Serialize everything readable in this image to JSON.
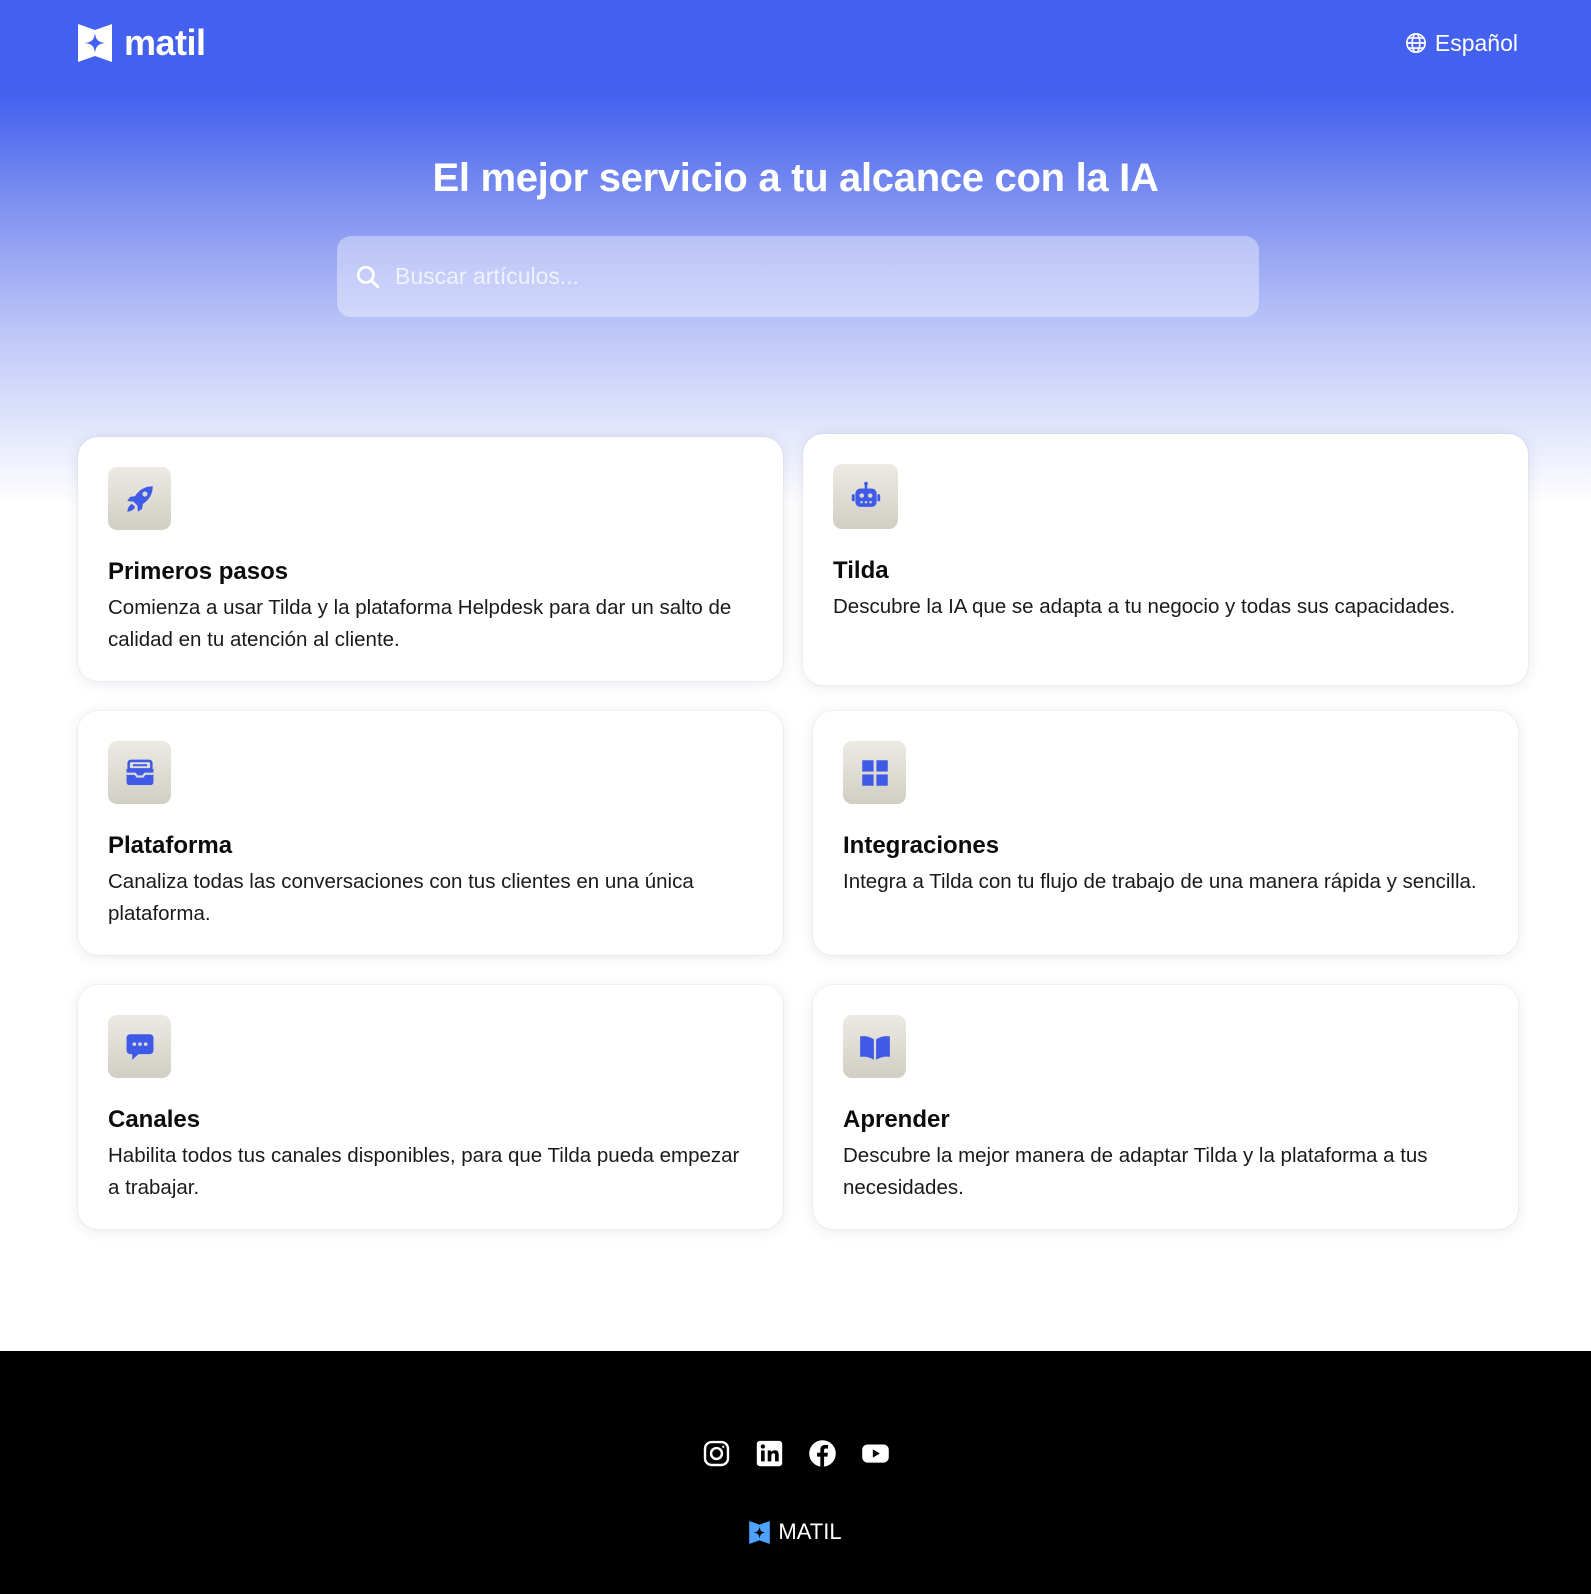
{
  "header": {
    "brand": "matil",
    "language": "Español"
  },
  "hero": {
    "title": "El mejor servicio a tu alcance con la IA",
    "search_placeholder": "Buscar artículos..."
  },
  "categories": [
    {
      "icon": "rocket-icon",
      "title": "Primeros pasos",
      "description": "Comienza a usar Tilda y la plataforma Helpdesk para dar un salto de calidad en tu atención al cliente."
    },
    {
      "icon": "robot-icon",
      "title": "Tilda",
      "description": "Descubre la IA que se adapta a tu negocio y todas sus capacidades."
    },
    {
      "icon": "inbox-icon",
      "title": "Plataforma",
      "description": "Canaliza todas las conversaciones con tus clientes en una única plataforma."
    },
    {
      "icon": "grid-icon",
      "title": "Integraciones",
      "description": "Integra a Tilda con tu flujo de trabajo de una manera rápida y sencilla."
    },
    {
      "icon": "chat-bubble-icon",
      "title": "Canales",
      "description": "Habilita todos tus canales disponibles, para que Tilda pueda empezar a trabajar."
    },
    {
      "icon": "book-icon",
      "title": "Aprender",
      "description": "Descubre la mejor manera de adaptar Tilda y la plataforma a tus necesidades."
    }
  ],
  "footer": {
    "socials": [
      "instagram-icon",
      "linkedin-icon",
      "facebook-icon",
      "youtube-icon"
    ],
    "brand": "MATIL"
  },
  "colors": {
    "accent": "#4361ee",
    "icon_color": "#3f5ae6",
    "footer_bg": "#000000"
  }
}
